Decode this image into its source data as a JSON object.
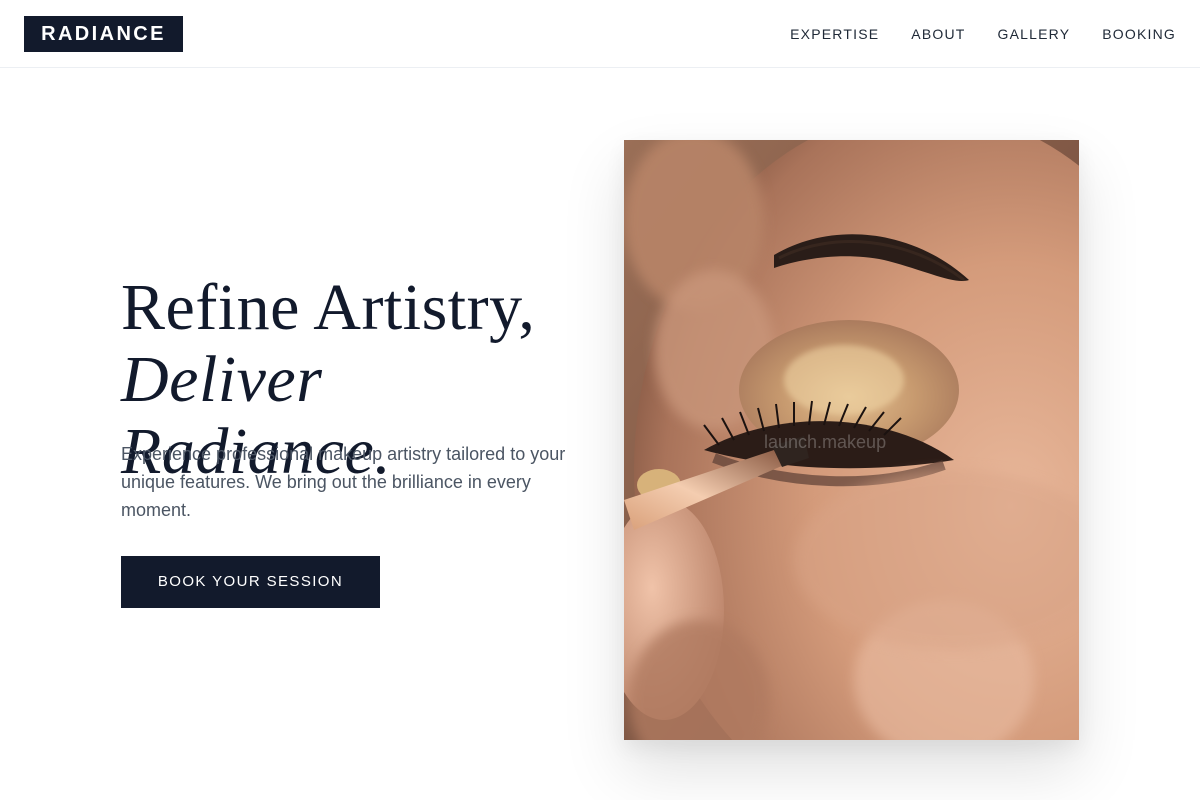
{
  "header": {
    "logo": "RADIANCE",
    "nav": [
      {
        "label": "EXPERTISE"
      },
      {
        "label": "ABOUT"
      },
      {
        "label": "GALLERY"
      },
      {
        "label": "BOOKING"
      }
    ]
  },
  "hero": {
    "headline_line1": "Refine Artistry,",
    "headline_line2": "Deliver Radiance.",
    "description": "Experience professional makeup artistry tailored to your unique features. We bring out the brilliance in every moment.",
    "cta_label": "BOOK YOUR SESSION",
    "image_watermark": "launch.makeup"
  },
  "colors": {
    "primary": "#121a2c",
    "body_text": "#4b5563",
    "background": "#ffffff"
  }
}
